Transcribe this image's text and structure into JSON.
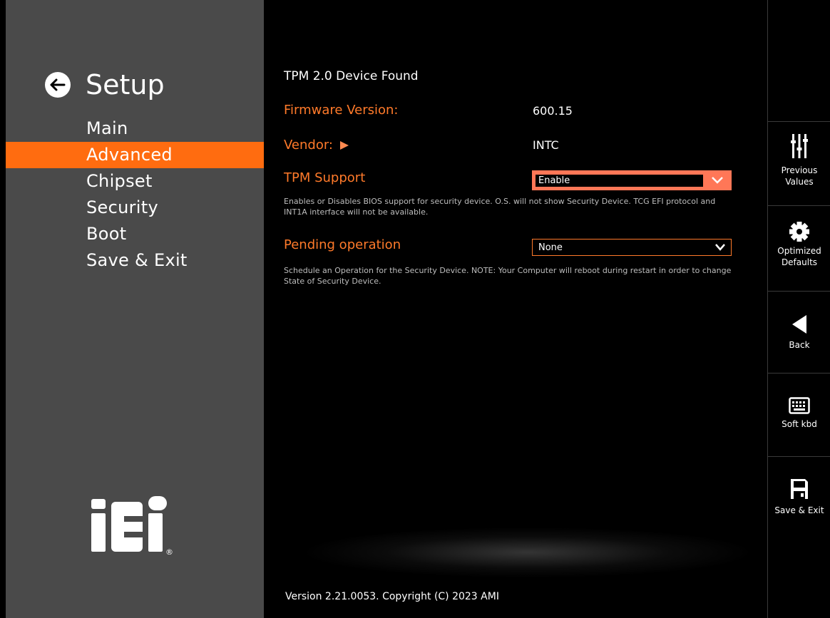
{
  "sidebar": {
    "title": "Setup",
    "items": [
      {
        "label": "Main"
      },
      {
        "label": "Advanced",
        "active": true
      },
      {
        "label": "Chipset"
      },
      {
        "label": "Security"
      },
      {
        "label": "Boot"
      },
      {
        "label": "Save & Exit"
      }
    ],
    "logo": "iEi",
    "logo_mark": "®"
  },
  "main": {
    "device_found": "TPM 2.0 Device Found",
    "firmware_label": "Firmware Version:",
    "firmware_value": "600.15",
    "vendor_label": "Vendor:",
    "vendor_value": "INTC",
    "tpm_support_label": "TPM Support",
    "tpm_support_value": "Enable",
    "tpm_support_help": "Enables or Disables BIOS support for security device. O.S. will not show Security Device. TCG EFI protocol and INT1A interface will not be available.",
    "pending_label": "Pending operation",
    "pending_value": "None",
    "pending_help": "Schedule an Operation for the Security Device. NOTE: Your Computer will reboot during restart in order to change State of Security Device.",
    "version": "Version 2.21.0053. Copyright (C) 2023 AMI"
  },
  "rightbar": {
    "previous_values": "Previous Values",
    "optimized_defaults": "Optimized Defaults",
    "back": "Back",
    "soft_kbd": "Soft kbd",
    "save_exit": "Save & Exit"
  },
  "colors": {
    "accent": "#ff6c10",
    "label": "#ff7a2a",
    "dropdown_highlight": "#ff7757",
    "sidebar_bg": "#4a4a4a"
  },
  "icons": [
    "back-arrow-icon",
    "sliders-icon",
    "gear-icon",
    "back-triangle-icon",
    "keyboard-icon",
    "floppy-save-icon",
    "chevron-down-icon"
  ]
}
